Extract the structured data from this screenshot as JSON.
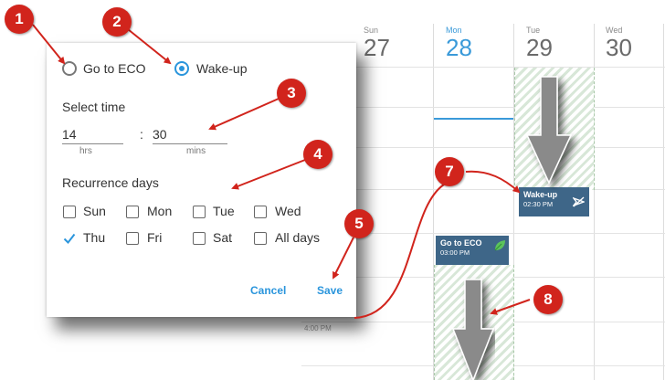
{
  "calendar": {
    "days": [
      {
        "name": "Sun",
        "date": "27"
      },
      {
        "name": "Mon",
        "date": "28"
      },
      {
        "name": "Tue",
        "date": "29"
      },
      {
        "name": "Wed",
        "date": "30"
      }
    ],
    "events": [
      {
        "title": "Wake-up",
        "time": "02:30 PM",
        "icon": "eco-off-icon"
      },
      {
        "title": "Go to ECO",
        "time": "03:00 PM",
        "icon": "leaf-icon"
      }
    ],
    "time_label": "4:00 PM"
  },
  "dialog": {
    "options": [
      {
        "label": "Go to ECO",
        "selected": false
      },
      {
        "label": "Wake-up",
        "selected": true
      }
    ],
    "select_time_label": "Select time",
    "hours_value": "14",
    "hours_unit": "hrs",
    "separator": ":",
    "mins_value": "30",
    "mins_unit": "mins",
    "recurrence_label": "Recurrence days",
    "days": [
      {
        "label": "Sun",
        "checked": false
      },
      {
        "label": "Mon",
        "checked": false
      },
      {
        "label": "Tue",
        "checked": false
      },
      {
        "label": "Wed",
        "checked": false
      },
      {
        "label": "Thu",
        "checked": true
      },
      {
        "label": "Fri",
        "checked": false
      },
      {
        "label": "Sat",
        "checked": false
      },
      {
        "label": "All days",
        "checked": false
      }
    ],
    "cancel_label": "Cancel",
    "save_label": "Save"
  },
  "markers": [
    "1",
    "2",
    "3",
    "4",
    "5",
    "7",
    "8"
  ],
  "colors": {
    "accent": "#2a95dc",
    "marker": "#d1241c",
    "event": "#3e6688",
    "arrow": "#8a8a8a"
  }
}
